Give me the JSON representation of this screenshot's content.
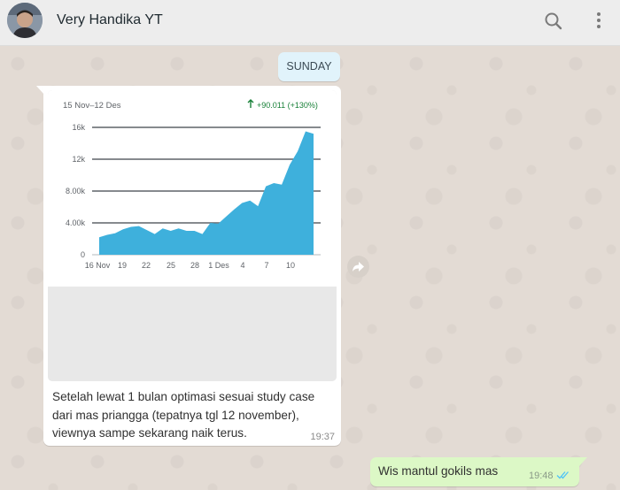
{
  "header": {
    "contact_name": "Very Handika YT",
    "icons": [
      "search-icon",
      "more-vert-icon"
    ]
  },
  "day_chip": "SUNDAY",
  "incoming_message": {
    "caption": "Setelah lewat 1 bulan optimasi sesuai study case dari mas priangga (tepatnya tgl 12 november), viewnya sampe sekarang naik terus.",
    "time": "19:37"
  },
  "outgoing_message": {
    "text": "Wis mantul gokils mas",
    "time": "19:48",
    "status_icon": "double-check-icon"
  },
  "colors": {
    "chart_fill": "#3eb0dc",
    "growth_green": "#188038",
    "outgoing_bubble": "#dcf8c6",
    "chat_bg": "#e5ddd5"
  },
  "chart_data": {
    "type": "area",
    "title": "15 Nov–12 Des",
    "growth_label": "+90.011 (+130%)",
    "x_tick_labels": [
      "16 Nov",
      "19",
      "22",
      "25",
      "28",
      "1 Des",
      "4",
      "7",
      "10"
    ],
    "y_tick_labels": [
      "0",
      "4.00k",
      "8.00k",
      "12k",
      "16k"
    ],
    "ylim": [
      0,
      16000
    ],
    "grid": true,
    "series": [
      {
        "x": [
          0,
          1,
          2,
          3,
          4,
          5,
          6,
          7,
          8,
          9,
          10,
          11,
          12,
          13,
          14,
          15,
          16,
          17,
          18,
          19,
          20,
          21,
          22,
          23,
          24,
          25,
          26,
          27
        ],
        "values": [
          2200,
          2500,
          2700,
          3200,
          3500,
          3600,
          3100,
          2600,
          3300,
          3000,
          3300,
          3000,
          3000,
          2600,
          4000,
          3900,
          4800,
          5700,
          6500,
          6800,
          6100,
          8600,
          9000,
          8800,
          11300,
          13000,
          15500,
          15200
        ]
      }
    ]
  }
}
